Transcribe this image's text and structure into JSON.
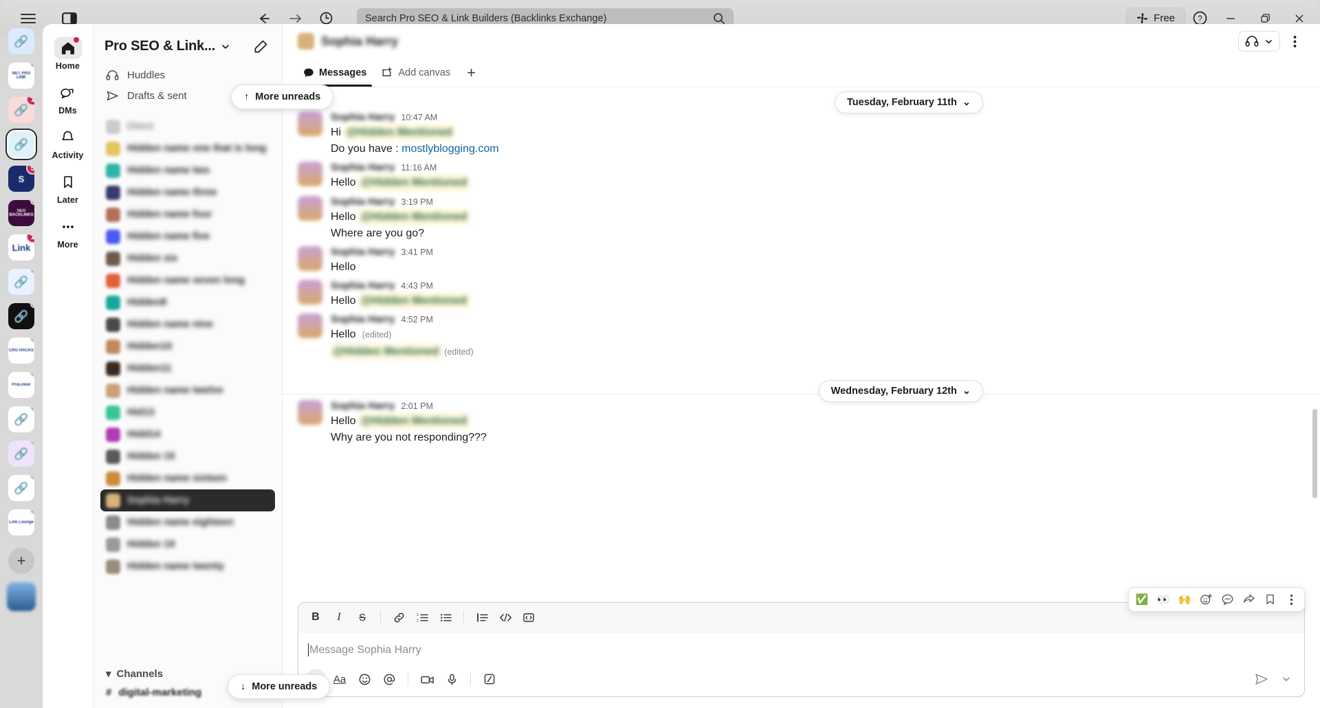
{
  "window": {
    "search_placeholder": "Search Pro SEO & Link Builders (Backlinks Exchange)",
    "free_label": "Free",
    "icons": {
      "hamburger": "hamburger-icon",
      "panel": "toggle-panel-icon",
      "back": "back-arrow-icon",
      "forward": "forward-arrow-icon",
      "history": "clock-history-icon",
      "search": "search-icon",
      "help": "help-circle-icon",
      "minimize": "minimize-icon",
      "maximize": "restore-window-icon",
      "close": "close-window-icon"
    }
  },
  "app_rail": {
    "workspaces": [
      {
        "name": "link-builders-blue",
        "abbr": "",
        "bg": "#dbeafe",
        "badge": "",
        "dot": false,
        "selected": false
      },
      {
        "name": "net-pro-link",
        "abbr": "NET PRO LINK",
        "bg": "#ffffff",
        "badge": "",
        "dot": true,
        "selected": false
      },
      {
        "name": "global-network",
        "abbr": "",
        "bg": "#fbdada",
        "badge": "1",
        "dot": false,
        "selected": false
      },
      {
        "name": "backlinks-exchange",
        "abbr": "",
        "bg": "#dff1fb",
        "badge": "",
        "dot": false,
        "selected": true
      },
      {
        "name": "sm-seo",
        "abbr": "S",
        "bg": "#1b2a6b",
        "badge": "5",
        "dot": false,
        "selected": false
      },
      {
        "name": "seo-backlinks",
        "abbr": "SEO BACKLINKS",
        "bg": "#3d0b3d",
        "badge": "",
        "dot": true,
        "selected": false
      },
      {
        "name": "link-workspace",
        "abbr": "Link",
        "bg": "#ffffff",
        "badge": "1",
        "dot": false,
        "selected": false
      },
      {
        "name": "blue-chain",
        "abbr": "",
        "bg": "#e8f3ff",
        "badge": "",
        "dot": true,
        "selected": false
      },
      {
        "name": "dark-mesh",
        "abbr": "",
        "bg": "#111111",
        "badge": "",
        "dot": true,
        "selected": false
      },
      {
        "name": "cro-hacks",
        "abbr": "CRO HACKS",
        "bg": "#ffffff",
        "badge": "",
        "dot": true,
        "selected": false
      },
      {
        "name": "prolinker",
        "abbr": "ProLinker",
        "bg": "#ffffff",
        "badge": "",
        "dot": true,
        "selected": false
      },
      {
        "name": "squares-teal",
        "abbr": "",
        "bg": "#ffffff",
        "badge": "",
        "dot": true,
        "selected": false
      },
      {
        "name": "cat-avatar",
        "abbr": "",
        "bg": "#efe4f7",
        "badge": "",
        "dot": true,
        "selected": false
      },
      {
        "name": "knot-blue",
        "abbr": "",
        "bg": "#ffffff",
        "badge": "",
        "dot": true,
        "selected": false
      },
      {
        "name": "link-lounge",
        "abbr": "Link Lounge",
        "bg": "#ffffff",
        "badge": "",
        "dot": true,
        "selected": false
      }
    ],
    "add_label": "+"
  },
  "nav_rail": {
    "items": [
      {
        "label": "Home",
        "icon": "home-icon",
        "active": true,
        "dot": true
      },
      {
        "label": "DMs",
        "icon": "dms-icon",
        "active": false,
        "dot": false
      },
      {
        "label": "Activity",
        "icon": "bell-icon",
        "active": false,
        "dot": false
      },
      {
        "label": "Later",
        "icon": "bookmark-icon",
        "active": false,
        "dot": false
      },
      {
        "label": "More",
        "icon": "more-dots-icon",
        "active": false,
        "dot": false
      }
    ]
  },
  "sidebar": {
    "workspace_name": "Pro SEO & Link...",
    "compose_icon": "compose-icon",
    "quick_links": [
      {
        "label": "Huddles",
        "icon": "headphones-icon"
      },
      {
        "label": "Drafts & sent",
        "icon": "paper-plane-icon"
      }
    ],
    "unreads_top": {
      "label": "More unreads",
      "arrow": "↑"
    },
    "unreads_bottom": {
      "label": "More unreads",
      "arrow": "↓"
    },
    "dm_section_label": "Direct",
    "dms": [
      {
        "name": "Hidden name one that is long",
        "color": "#e4c45c",
        "selected": false
      },
      {
        "name": "Hidden name two",
        "color": "#2fb3a8",
        "selected": false
      },
      {
        "name": "Hidden name three",
        "color": "#3b3b6b",
        "selected": false
      },
      {
        "name": "Hidden name four",
        "color": "#b2705a",
        "selected": false
      },
      {
        "name": "Hidden name five",
        "color": "#4a5cf0",
        "selected": false
      },
      {
        "name": "Hidden six",
        "color": "#6b5a4a",
        "selected": false
      },
      {
        "name": "Hidden name seven long",
        "color": "#e0603a",
        "selected": false
      },
      {
        "name": "Hidden8",
        "color": "#16a79a",
        "selected": false
      },
      {
        "name": "Hidden name nine",
        "color": "#4a4a4a",
        "selected": false
      },
      {
        "name": "Hidden10",
        "color": "#c08a5a",
        "selected": false
      },
      {
        "name": "Hidden11",
        "color": "#3a2a20",
        "selected": false
      },
      {
        "name": "Hidden name twelve",
        "color": "#c9a07a",
        "selected": false
      },
      {
        "name": "Hid13",
        "color": "#36c49a",
        "selected": false
      },
      {
        "name": "Hidd14",
        "color": "#b23ab2",
        "selected": false
      },
      {
        "name": "Hidden 15",
        "color": "#5a5a5a",
        "selected": false
      },
      {
        "name": "Hidden name sixteen",
        "color": "#c98a3a",
        "selected": false
      },
      {
        "name": "Sophia Harry",
        "color": "#d8b07a",
        "selected": true
      },
      {
        "name": "Hidden name eighteen",
        "color": "#8a8a8a",
        "selected": false
      },
      {
        "name": "Hidden 19",
        "color": "#9a9a9a",
        "selected": false
      },
      {
        "name": "Hidden name twenty",
        "color": "#9a8a7a",
        "selected": false
      }
    ],
    "channels_section": {
      "label": "Channels",
      "chevron": "▾"
    },
    "channels": [
      {
        "label": "digital-marketing",
        "prefix": "#"
      }
    ]
  },
  "conversation": {
    "title": "Sophia Harry",
    "header_icons": {
      "huddle": "headphones-icon",
      "chevron": "chevron-down-icon",
      "more": "kebab-menu-icon"
    },
    "tabs": [
      {
        "label": "Messages",
        "icon": "message-bubble-icon",
        "active": true
      },
      {
        "label": "Add canvas",
        "icon": "canvas-icon",
        "active": false
      }
    ],
    "add_tab": "+",
    "date_dividers": [
      {
        "label": "Tuesday, February 11th",
        "chevron": "⌄"
      },
      {
        "label": "Wednesday, February 12th",
        "chevron": "⌄"
      }
    ],
    "messages": [
      {
        "sender": "Sophia Harry",
        "time": "10:47 AM",
        "lines": [
          {
            "prefix": "Hi ",
            "mention": "@Hidden Mentioned",
            "suffix": ""
          },
          {
            "prefix": "Do you have : ",
            "link": "mostlyblogging.com",
            "suffix": ""
          }
        ]
      },
      {
        "sender": "Sophia Harry",
        "time": "11:16 AM",
        "lines": [
          {
            "prefix": "Hello ",
            "mention": "@Hidden Mentioned",
            "suffix": ""
          }
        ]
      },
      {
        "sender": "Sophia Harry",
        "time": "3:19 PM",
        "lines": [
          {
            "prefix": "Hello ",
            "mention": "@Hidden Mentioned",
            "suffix": ""
          },
          {
            "prefix": "Where are you go?",
            "suffix": ""
          }
        ]
      },
      {
        "sender": "Sophia Harry",
        "time": "3:41 PM",
        "lines": [
          {
            "prefix": "Hello",
            "suffix": ""
          }
        ]
      },
      {
        "sender": "Sophia Harry",
        "time": "4:43 PM",
        "lines": [
          {
            "prefix": "Hello ",
            "mention": "@Hidden Mentioned",
            "suffix": ""
          }
        ]
      },
      {
        "sender": "Sophia Harry",
        "time": "4:52 PM",
        "lines": [
          {
            "prefix": "Hello ",
            "edited": "(edited)",
            "suffix": ""
          },
          {
            "mention": "@Hidden Mentioned",
            "edited": "(edited)",
            "suffix": ""
          }
        ]
      },
      {
        "sender": "Sophia Harry",
        "time": "2:01 PM",
        "lines": [
          {
            "prefix": "Hello ",
            "mention": "@Hidden Mentioned",
            "suffix": ""
          },
          {
            "prefix": "Why are you not responding???",
            "suffix": ""
          }
        ]
      }
    ]
  },
  "composer": {
    "placeholder": "Message Sophia Harry",
    "format_buttons": [
      {
        "name": "bold-button",
        "glyph": "B"
      },
      {
        "name": "italic-button",
        "glyph": "I"
      },
      {
        "name": "strikethrough-button",
        "glyph": "S"
      },
      {
        "name": "link-button",
        "glyph": "link"
      },
      {
        "name": "ordered-list-button",
        "glyph": "ol"
      },
      {
        "name": "bulleted-list-button",
        "glyph": "ul"
      },
      {
        "name": "blockquote-button",
        "glyph": "quote"
      },
      {
        "name": "code-button",
        "glyph": "</>"
      },
      {
        "name": "code-block-button",
        "glyph": "codeblock"
      }
    ],
    "action_buttons": [
      {
        "name": "plus-attach-button",
        "glyph": "+"
      },
      {
        "name": "formatting-button",
        "glyph": "Aa"
      },
      {
        "name": "emoji-button",
        "glyph": "emoji"
      },
      {
        "name": "mention-button",
        "glyph": "@"
      },
      {
        "name": "video-clip-button",
        "glyph": "video"
      },
      {
        "name": "audio-clip-button",
        "glyph": "mic"
      },
      {
        "name": "slash-command-button",
        "glyph": "slash"
      }
    ],
    "send_icon": "send-icon",
    "send_options_icon": "chevron-down-icon"
  },
  "hover_toolbar": {
    "buttons": [
      {
        "name": "white-check-mark-reaction",
        "glyph": "✅"
      },
      {
        "name": "eyes-reaction",
        "glyph": "👀"
      },
      {
        "name": "raised-hands-reaction",
        "glyph": "🙌"
      },
      {
        "name": "add-reaction-button",
        "glyph": "add-reaction"
      },
      {
        "name": "reply-in-thread-button",
        "glyph": "thread"
      },
      {
        "name": "share-message-button",
        "glyph": "share"
      },
      {
        "name": "save-for-later-button",
        "glyph": "bookmark"
      },
      {
        "name": "more-actions-button",
        "glyph": "⋮"
      }
    ]
  }
}
